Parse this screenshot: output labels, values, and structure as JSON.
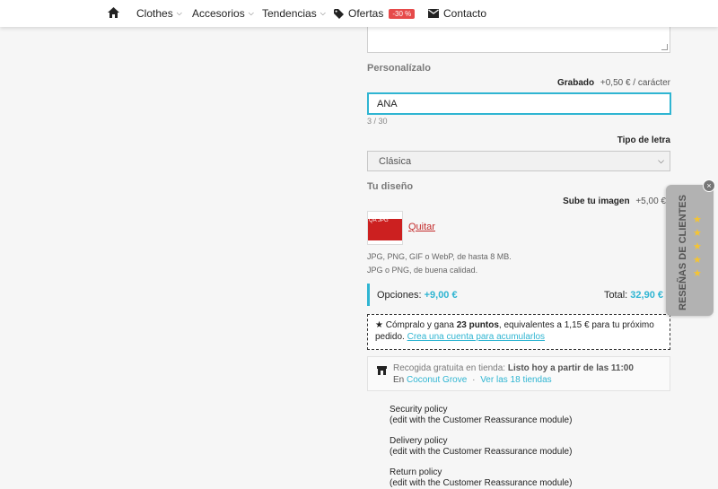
{
  "nav": {
    "home_icon": "home-icon",
    "items": [
      {
        "label": "Clothes",
        "has_dropdown": true
      },
      {
        "label": "Accesorios",
        "has_dropdown": true
      },
      {
        "label": "Tendencias",
        "has_dropdown": true
      },
      {
        "label": "Ofertas",
        "badge": "-30 %"
      },
      {
        "label": "Contacto"
      }
    ]
  },
  "personalize": {
    "section_title": "Personalízalo",
    "engraving_label": "Grabado",
    "engraving_price": "+0,50 € / carácter",
    "engraving_value": "ANA",
    "engraving_counter": "3 / 30",
    "font_label": "Tipo de letra",
    "font_selected": "Clásica"
  },
  "design": {
    "section_title": "Tu diseño",
    "upload_label": "Sube tu imagen",
    "upload_price": "+5,00 €",
    "thumb_label": "QA JPG",
    "remove_label": "Quitar",
    "hint_1": "JPG, PNG, GIF o WebP, de hasta 8 MB.",
    "hint_2": "JPG o PNG, de buena calidad."
  },
  "summary": {
    "options_label": "Opciones:",
    "options_value": "+9,00 €",
    "total_label": "Total:",
    "total_value": "32,90 €"
  },
  "points": {
    "prefix": "★ Cómpralo y gana",
    "points": "23 puntos",
    "suffix": ", equivalentes a 1,15 € para tu próximo pedido.",
    "link": "Crea una cuenta para acumularlos"
  },
  "pickup": {
    "label": "Recogida gratuita en tienda:",
    "status": "Listo hoy a partir de las 11:00",
    "prefix": "En",
    "store": "Coconut Grove",
    "sep": "·",
    "all_stores": "Ver las 18 tiendas"
  },
  "policies": [
    {
      "title": "Security policy",
      "sub": "(edit with the Customer Reassurance module)"
    },
    {
      "title": "Delivery policy",
      "sub": "(edit with the Customer Reassurance module)"
    },
    {
      "title": "Return policy",
      "sub": "(edit with the Customer Reassurance module)"
    }
  ],
  "reviews_tab": {
    "label": "RESEÑAS DE CLIENTES",
    "stars": 5,
    "close": "×"
  },
  "colors": {
    "accent": "#2fb5d2",
    "badge": "#e64a4a",
    "remove_link": "#c32a2a",
    "star": "#f5c431"
  }
}
